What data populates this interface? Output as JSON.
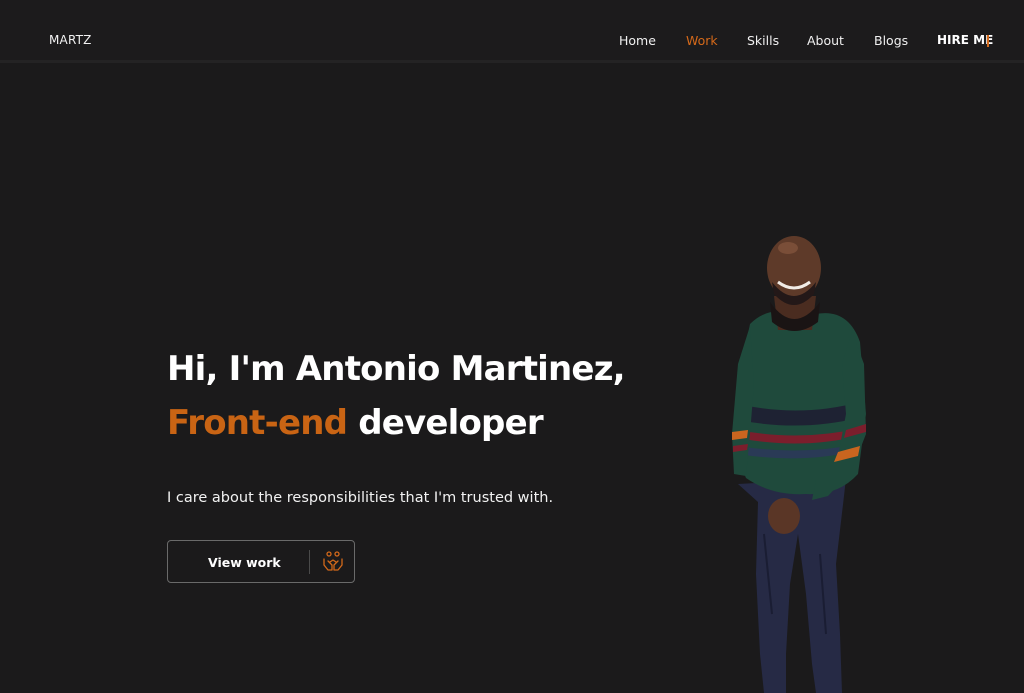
{
  "nav": {
    "brand": "MARTZ",
    "items": [
      {
        "label": "Home",
        "active": false
      },
      {
        "label": "Work",
        "active": true
      },
      {
        "label": "Skills",
        "active": false
      },
      {
        "label": "About",
        "active": false
      },
      {
        "label": "Blogs",
        "active": false
      }
    ],
    "hire": "HIRE ME"
  },
  "hero": {
    "line1": "Hi, I'm Antonio Martinez,",
    "accent": "Front-end",
    "role": " developer",
    "tagline": "I care about the responsibilities that I'm trusted with.",
    "cta_label": "View work",
    "cta_icon": "handshake-icon"
  },
  "colors": {
    "background": "#1b1a1b",
    "accent": "#c96414",
    "text": "#ffffff"
  }
}
